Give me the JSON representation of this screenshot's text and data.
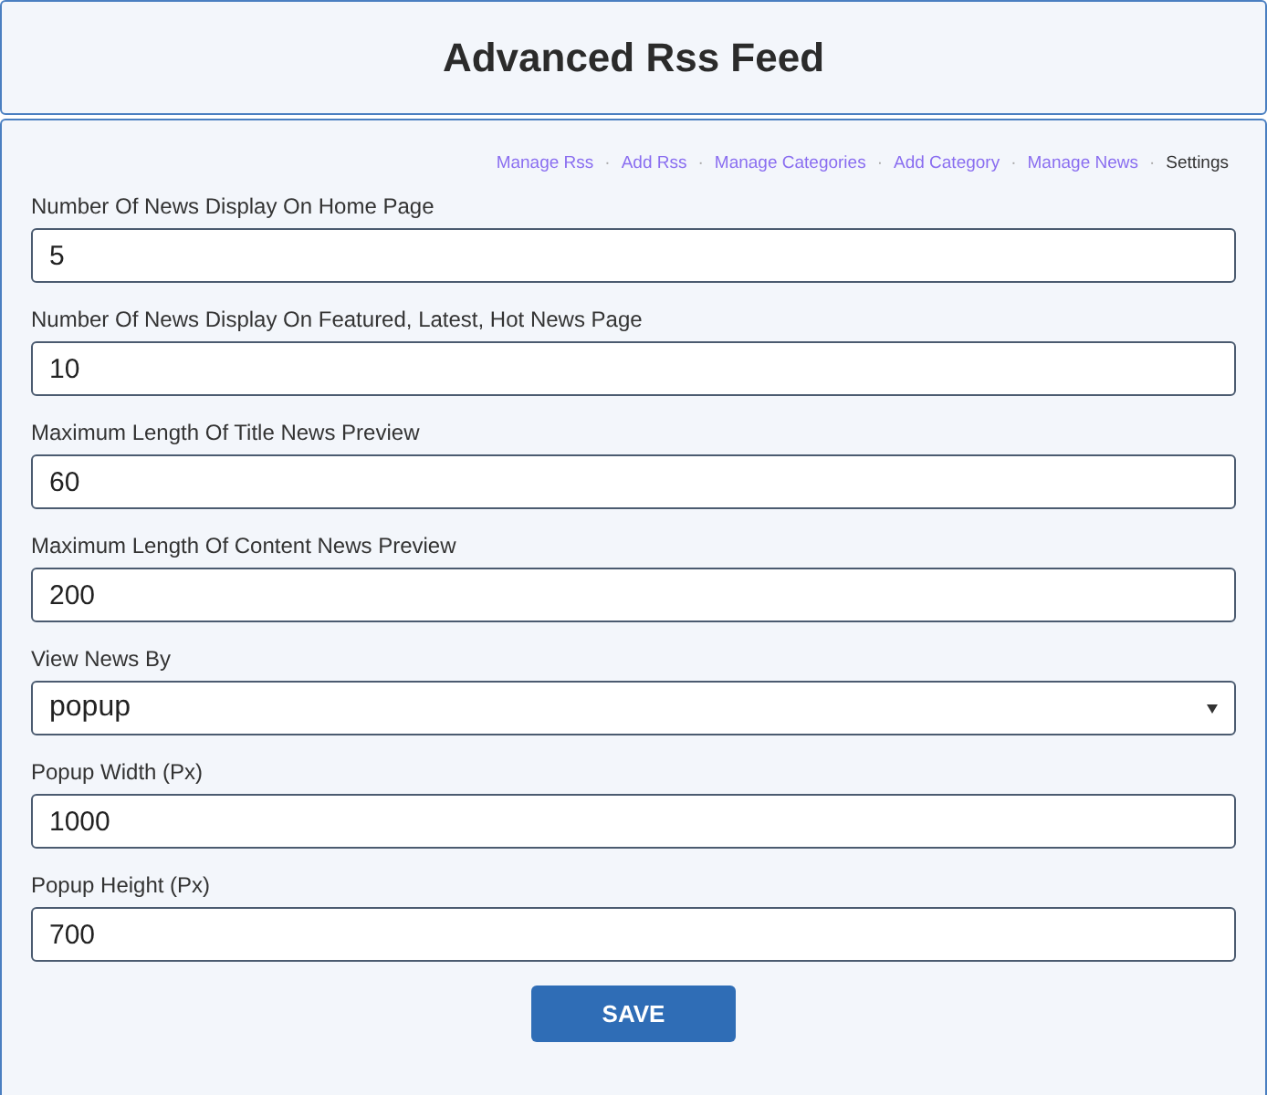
{
  "title": "Advanced Rss Feed",
  "nav": {
    "separator": "·",
    "items": [
      {
        "label": "Manage Rss",
        "selected": false
      },
      {
        "label": "Add Rss",
        "selected": false
      },
      {
        "label": "Manage Categories",
        "selected": false
      },
      {
        "label": "Add Category",
        "selected": false
      },
      {
        "label": "Manage News",
        "selected": false
      },
      {
        "label": "Settings",
        "selected": true
      }
    ]
  },
  "fields": [
    {
      "kind": "text",
      "label": "Number Of News Display On Home Page",
      "value": "5"
    },
    {
      "kind": "text",
      "label": "Number Of News Display On Featured, Latest, Hot News Page",
      "value": "10"
    },
    {
      "kind": "text",
      "label": "Maximum Length Of Title News Preview",
      "value": "60"
    },
    {
      "kind": "text",
      "label": "Maximum Length Of Content News Preview",
      "value": "200"
    },
    {
      "kind": "select",
      "label": "View News By",
      "value": "popup"
    },
    {
      "kind": "text",
      "label": "Popup Width (Px)",
      "value": "1000"
    },
    {
      "kind": "text",
      "label": "Popup Height (Px)",
      "value": "700"
    }
  ],
  "button": "SAVE"
}
